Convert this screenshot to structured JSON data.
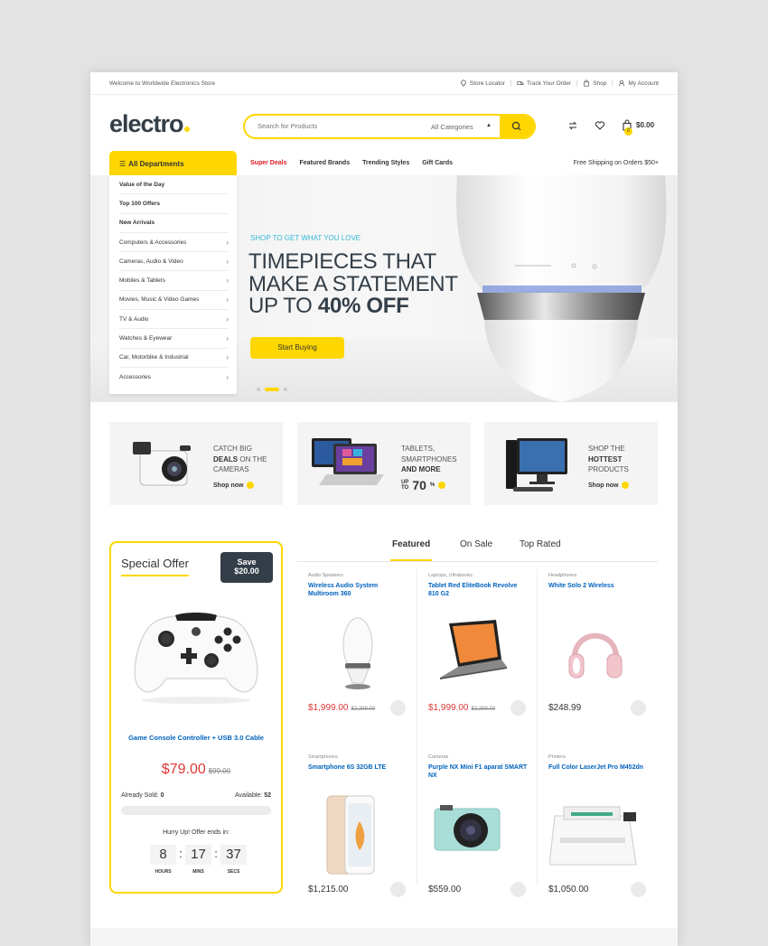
{
  "topbar": {
    "welcome": "Welcome to Worldwide Electronics Store",
    "links": [
      "Store Locator",
      "Track Your Order",
      "Shop",
      "My Account"
    ]
  },
  "header": {
    "logo": "electro",
    "search_placeholder": "Search for Products",
    "category": "All Categories",
    "cart_count": "0",
    "cart_total": "$0.00"
  },
  "nav": {
    "departments": "All Departments",
    "items": [
      "Super Deals",
      "Featured Brands",
      "Trending Styles",
      "Gift Cards"
    ],
    "shipping": "Free Shipping on Orders $50+"
  },
  "departments": [
    "Value of the Day",
    "Top 100 Offers",
    "New Arrivals",
    "Computers & Accessories",
    "Cameras, Audio & Video",
    "Mobiles & Tablets",
    "Movies, Music & Video Games",
    "TV & Audio",
    "Watches & Eyewear",
    "Car, Motorbike & Industrial",
    "Accessories"
  ],
  "hero": {
    "kicker": "SHOP TO GET WHAT YOU LOVE",
    "line1": "TIMEPIECES THAT",
    "line2": "MAKE A STATEMENT",
    "line3_prefix": "UP TO ",
    "line3_bold": "40% OFF",
    "button": "Start Buying"
  },
  "banners": [
    {
      "line1": "CATCH BIG",
      "bold": "DEALS",
      "rest": " ON THE",
      "line3": "CAMERAS",
      "shop": "Shop now"
    },
    {
      "line1": "TABLETS,",
      "line2": "SMARTPHONES",
      "bold": "AND MORE",
      "up": "UP",
      "to": "TO",
      "big": "70",
      "unit": "%"
    },
    {
      "line1": "SHOP THE",
      "bold": "HOTTEST",
      "line3": "PRODUCTS",
      "shop": "Shop now"
    }
  ],
  "offer": {
    "title": "Special Offer",
    "save_label": "Save",
    "save_amount": "$20.00",
    "product": "Game Console Controller + USB 3.0 Cable",
    "price": "$79.00",
    "old_price": "$99.00",
    "sold_label": "Already Sold:",
    "sold": "0",
    "avail_label": "Available:",
    "avail": "52",
    "hurry": "Hurry Up! Offer ends in:",
    "hours": "8",
    "mins": "17",
    "secs": "37",
    "hours_label": "HOURS",
    "mins_label": "MINS",
    "secs_label": "SECS"
  },
  "tabs": [
    "Featured",
    "On Sale",
    "Top Rated"
  ],
  "products": [
    {
      "cat": "Audio Speakers",
      "name": "Wireless Audio System Multiroom 360",
      "price": "$1,999.00",
      "old": "$2,299.00"
    },
    {
      "cat": "Laptops, Ultrabooks",
      "name": "Tablet Red EliteBook Revolve 810 G2",
      "price": "$1,999.00",
      "old": "$2,299.00"
    },
    {
      "cat": "Headphones",
      "name": "White Solo 2 Wireless",
      "price": "$248.99",
      "old": ""
    },
    {
      "cat": "Smartphones",
      "name": "Smartphone 6S 32GB LTE",
      "price": "$1,215.00",
      "old": ""
    },
    {
      "cat": "Cameras",
      "name": "Purple NX Mini F1 aparat SMART NX",
      "price": "$559.00",
      "old": ""
    },
    {
      "cat": "Printers",
      "name": "Full Color LaserJet Pro M452dn",
      "price": "$1,050.00",
      "old": ""
    }
  ],
  "colors": {
    "accent": "#fed700",
    "link": "#0062bd",
    "sale": "#df3737",
    "dark": "#333e48",
    "kicker": "#35b8d8"
  }
}
